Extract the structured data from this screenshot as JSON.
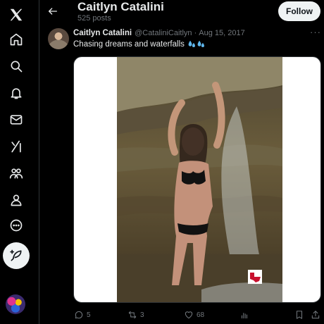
{
  "nav": {
    "items": [
      {
        "name": "x-logo-icon"
      },
      {
        "name": "home-icon"
      },
      {
        "name": "search-icon"
      },
      {
        "name": "notifications-icon"
      },
      {
        "name": "messages-icon"
      },
      {
        "name": "grok-icon"
      },
      {
        "name": "communities-icon"
      },
      {
        "name": "profile-icon"
      },
      {
        "name": "more-icon"
      }
    ],
    "post_icon": "feather-plus-icon"
  },
  "header": {
    "name": "Caitlyn Catalini",
    "posts_count": "525 posts",
    "follow_label": "Follow"
  },
  "tweet": {
    "author_name": "Caitlyn Catalini",
    "handle": "@CataliniCaitlyn",
    "separator": "·",
    "date": "Aug 15, 2017",
    "text": "Chasing dreams and waterfalls",
    "emoji": "sweat-droplets-emoji",
    "more_glyph": "···"
  },
  "actions": {
    "replies": "5",
    "reposts": "3",
    "likes": "68"
  },
  "colors": {
    "background": "#000000",
    "text": "#e7e9ea",
    "muted": "#71767b",
    "divider": "#2f3336",
    "button_bg": "#eff3f4",
    "droplets": "#5fb6ec"
  }
}
